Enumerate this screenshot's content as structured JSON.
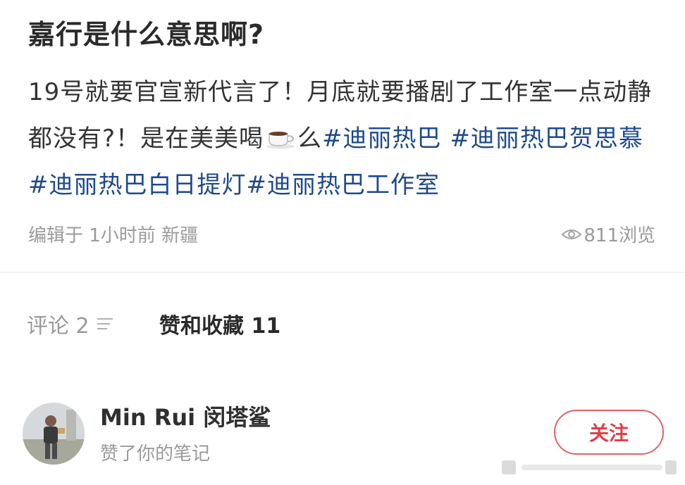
{
  "post": {
    "title": "嘉行是什么意思啊?",
    "text_part1": "19号就要官宣新代言了！月底就要播剧了工作室一点动静都没有?！是在美美喝",
    "text_part2": "么",
    "tags": [
      "#迪丽热巴",
      "#迪丽热巴贺思慕",
      "#迪丽热巴白日提灯",
      "#迪丽热巴工作室"
    ],
    "cup_icon": "coffee-cup-icon",
    "meta": {
      "edited": "编辑于 1小时前 新疆",
      "views": "811浏览",
      "view_icon": "eye-icon"
    }
  },
  "tabs": {
    "comments": "评论 2",
    "comments_icon": "sort-lines-icon",
    "likes": "赞和收藏 11"
  },
  "like_entry": {
    "name": "Min Rui 闵塔鲨",
    "action": "赞了你的笔记",
    "follow_label": "关注"
  },
  "colors": {
    "tag": "#1f4a8a",
    "follow": "#e0404b"
  }
}
